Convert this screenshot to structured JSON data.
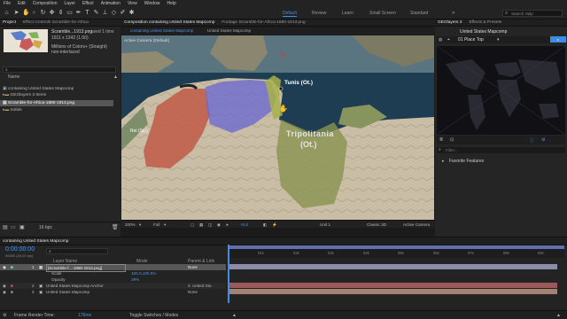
{
  "menu": [
    "File",
    "Edit",
    "Composition",
    "Layer",
    "Effect",
    "Animation",
    "View",
    "Window",
    "Help"
  ],
  "workspaces": [
    "Default",
    "Review",
    "Learn",
    "Small Screen",
    "Standard"
  ],
  "search_placeholder": "Search Help",
  "project": {
    "tabs": [
      "Project",
      "Effect Controls Scramble-for-Africa"
    ],
    "asset_name": "Scramble...1913.png",
    "asset_used": ", used 1 time",
    "asset_dims": "1911 x 1342 (1.00)",
    "asset_colors": "Millions of Colors+ (Straight)",
    "asset_interlace": "non-interlaced",
    "search_placeholder": "",
    "column_name": "Name",
    "items": [
      "containing United States Mapcomp",
      "GEOlayers 3 Items",
      "Scramble-for-Africa-1880-1913.png",
      "Solids"
    ],
    "bpc": "16 bpc"
  },
  "composition": {
    "tabs": [
      "Composition containing United States Mapcomp",
      "Footage Scramble-for-Africa-1880-1913.png"
    ],
    "breadcrumbs": [
      "containing United States Mapcomp",
      "United States Mapcomp"
    ],
    "camera": "Active Camera (Default)",
    "labels": {
      "tunis": "Tunis (Ot.)",
      "tripoli": "Tripolitania",
      "tripoli2": "(Ot.)",
      "rei": "Rei (Sp.)"
    },
    "zoom": "200%",
    "quality": "Full",
    "timecode": "+0.0",
    "view": "Unit 1",
    "renderer": "Classic 3D",
    "camera_btn": "Active Camera"
  },
  "geolayers": {
    "tabs": [
      "GEOlayers 3",
      "Effects & Presets"
    ],
    "comp": "United States Mapcomp",
    "place_label": "01 Place Top",
    "filter_placeholder": "Filter...",
    "favorites": "Favorite Features"
  },
  "timeline": {
    "tab": "containing United States Mapcomp",
    "current_time": "0:00:00:00",
    "fps": "00000 (30.00 fps)",
    "columns": {
      "source": "Layer Name",
      "mode": "Mode",
      "parent": "Parent & Link"
    },
    "layers": [
      {
        "num": "1",
        "name": "[Scramble-f...-1880-1913.png]",
        "parent": "None",
        "selected": true
      },
      {
        "num": "",
        "name": "Scale",
        "value": "100.0,100.0%",
        "selected": false
      },
      {
        "num": "",
        "name": "Opacity",
        "value": "28%",
        "selected": false
      },
      {
        "num": "2",
        "name": "United States Mapcomp Anchor",
        "parent": "3. United Sta",
        "selected": false
      },
      {
        "num": "3",
        "name": "United States Mapcomp",
        "parent": "None",
        "selected": false
      }
    ],
    "ruler": [
      "01s",
      "02s",
      "03s",
      "04s",
      "05s",
      "06s",
      "07s",
      "08s",
      "09s"
    ],
    "footer_left": "Frame Render Time:",
    "footer_time": "176ms",
    "footer_mid": "Toggle Switches / Modes"
  },
  "colors": {
    "accent": "#3d8de8",
    "work_area": "#5f6fb0",
    "layer1": "#8b8ca8",
    "layer2": "#9a5a5a",
    "layer3": "#a48272",
    "morocco": "#c05a45",
    "algeria": "#6a68d0",
    "tunisia": "#a7b24a",
    "libya": "#8a9450"
  }
}
